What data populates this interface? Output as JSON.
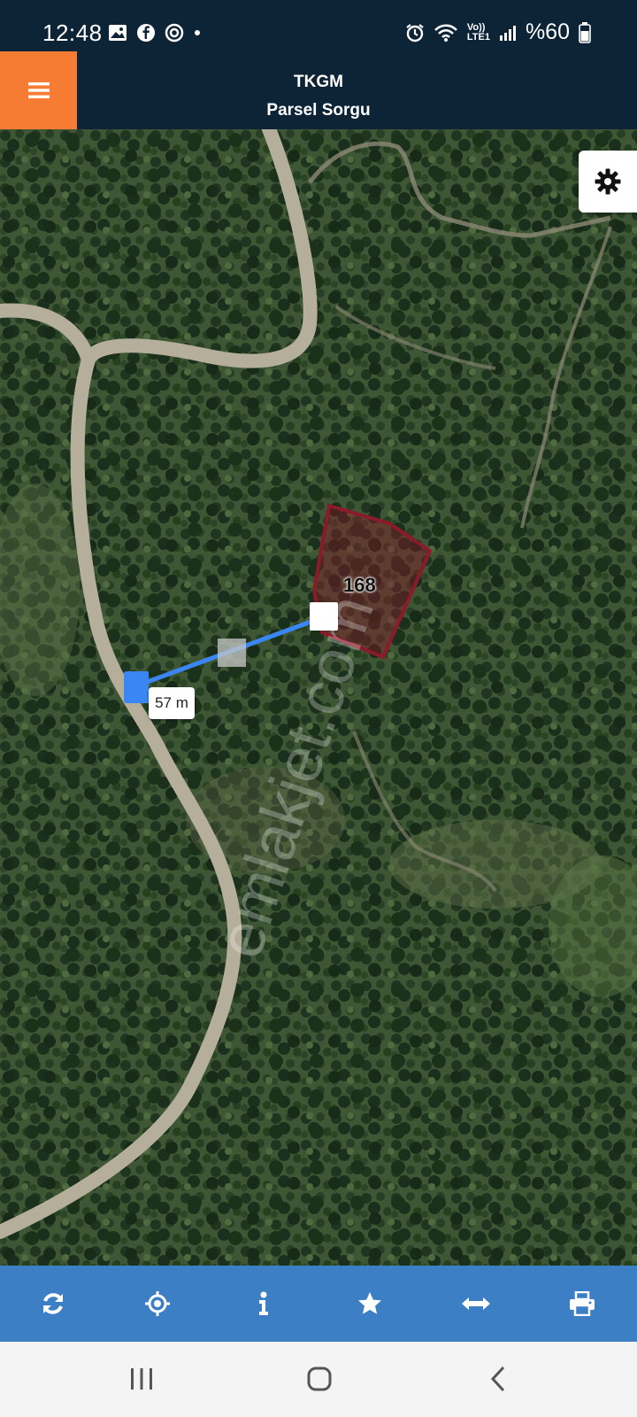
{
  "status_bar": {
    "time": "12:48",
    "battery_percent": "%60",
    "network_label_top": "Vo))",
    "network_label_bottom": "LTE1",
    "left_icons": [
      "gallery-icon",
      "facebook-icon",
      "sync-icon",
      "dot-icon"
    ],
    "right_icons": [
      "alarm-icon",
      "wifi-icon",
      "signal-icon",
      "battery-icon"
    ]
  },
  "app_bar": {
    "title": "TKGM",
    "subtitle": "Parsel Sorgu",
    "menu_icon": "hamburger-menu-icon",
    "accent_color": "#f57c32",
    "background_color": "#0d2436"
  },
  "map": {
    "parcel_number": "168",
    "measure_distance": "57 m",
    "watermark": "emlakjet.com",
    "parcel_color": "#8b1a2b",
    "measure_line_color": "#3b86f5",
    "settings_icon": "gear-icon"
  },
  "toolbar": {
    "background_color": "#3d7fc5",
    "tools": [
      {
        "name": "refresh",
        "icon": "refresh-icon"
      },
      {
        "name": "locate",
        "icon": "crosshair-icon"
      },
      {
        "name": "info",
        "icon": "info-icon"
      },
      {
        "name": "favorite",
        "icon": "star-icon"
      },
      {
        "name": "measure",
        "icon": "measure-arrows-icon"
      },
      {
        "name": "print",
        "icon": "print-icon"
      }
    ]
  },
  "nav_bar": {
    "buttons": [
      "recent-apps-icon",
      "home-icon",
      "back-icon"
    ]
  }
}
